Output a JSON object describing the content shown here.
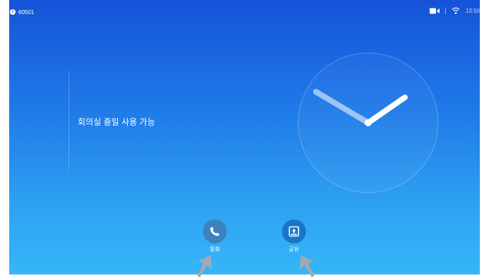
{
  "status_bar": {
    "system_id": "60501",
    "time": "13:50",
    "icons": [
      "info-icon",
      "camera-icon",
      "wifi-icon"
    ]
  },
  "room": {
    "status_text": "회의실 종일 사용 가능"
  },
  "actions": {
    "call_label": "통화",
    "share_label": "공유"
  },
  "colors": {
    "background_top": "#1553d8",
    "background_bottom": "#36b6f8",
    "call_button": "#3d81c0",
    "share_button": "#1975c6"
  }
}
